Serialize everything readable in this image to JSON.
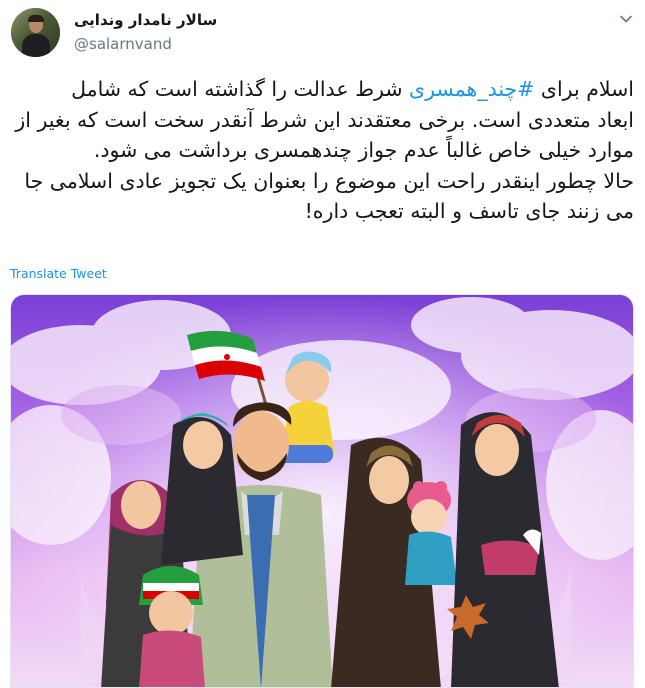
{
  "author": {
    "display_name": "سالار نامدار وندایی",
    "handle": "@salarnvand"
  },
  "tweet": {
    "lines": [
      {
        "pre": "اسلام برای ",
        "hashtag": "#چند_همسری",
        "post": " شرط عدالت را گذاشته است که شامل"
      },
      {
        "text": "ابعاد متعددی است. برخی معتقدند این شرط آنقدر سخت است که بغیر از"
      },
      {
        "text": "موارد خیلی خاص غالباً عدم جواز چندهمسری برداشت می شود."
      },
      {
        "text": "حالا چطور اینقدر راحت این موضوع را بعنوان یک تجویز عادی اسلامی جا"
      },
      {
        "text": "می زنند جای تاسف و البته تعجب داره!"
      }
    ]
  },
  "translate_label": "Translate Tweet",
  "icons": {
    "menu": "chevron-down-icon"
  },
  "colors": {
    "link": "#1b95e0",
    "text": "#14171a",
    "secondary": "#657786"
  }
}
